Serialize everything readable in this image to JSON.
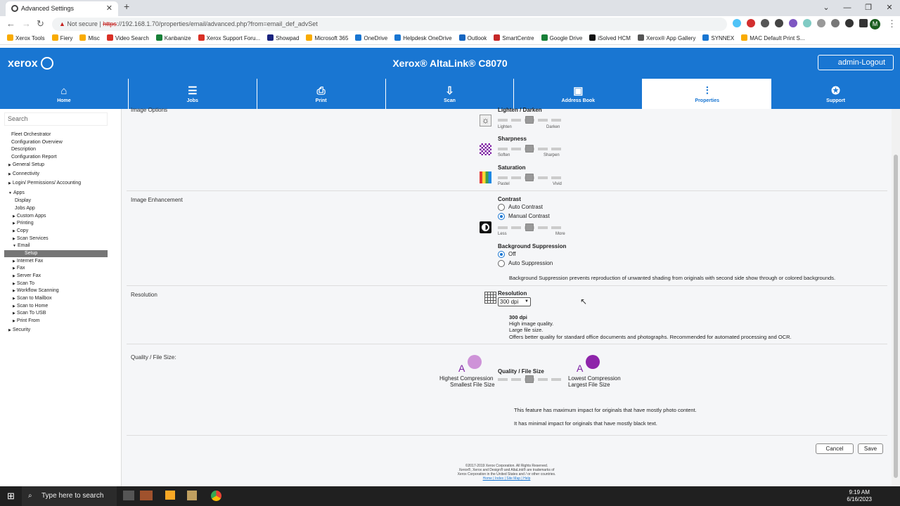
{
  "browser": {
    "tab_title": "Advanced Settings",
    "url_warning": "Not secure",
    "url_scheme": "https",
    "url_rest": "://192.168.1.70/properties/email/advanced.php?from=email_def_advSet"
  },
  "bookmarks": [
    {
      "label": "Xerox Tools",
      "color": "#f9ab00"
    },
    {
      "label": "Fiery",
      "color": "#f9ab00"
    },
    {
      "label": "Misc",
      "color": "#f9ab00"
    },
    {
      "label": "Video Search",
      "color": "#d93025"
    },
    {
      "label": "Kanbanize",
      "color": "#188038"
    },
    {
      "label": "Xerox Support Foru...",
      "color": "#d93025"
    },
    {
      "label": "Showpad",
      "color": "#1a237e"
    },
    {
      "label": "Microsoft 365",
      "color": "#f9ab00"
    },
    {
      "label": "OneDrive",
      "color": "#1976d2"
    },
    {
      "label": "Helpdesk OneDrive",
      "color": "#1976d2"
    },
    {
      "label": "Outlook",
      "color": "#1565c0"
    },
    {
      "label": "SmartCentre",
      "color": "#c62828"
    },
    {
      "label": "Google Drive",
      "color": "#188038"
    },
    {
      "label": "iSolved HCM",
      "color": "#111111"
    },
    {
      "label": "Xerox® App Gallery",
      "color": "#555555"
    },
    {
      "label": "SYNNEX",
      "color": "#1976d2"
    },
    {
      "label": "MAC Default Print S...",
      "color": "#f9ab00"
    }
  ],
  "header": {
    "logo": "xerox",
    "product": "Xerox® AltaLink® C8070",
    "logout": "admin-Logout"
  },
  "nav": [
    {
      "label": "Home",
      "icon": "⌂"
    },
    {
      "label": "Jobs",
      "icon": "☰"
    },
    {
      "label": "Print",
      "icon": "⎙"
    },
    {
      "label": "Scan",
      "icon": "⇩"
    },
    {
      "label": "Address Book",
      "icon": "▣"
    },
    {
      "label": "Properties",
      "icon": "⫶"
    },
    {
      "label": "Support",
      "icon": "✪"
    }
  ],
  "sidebar": {
    "search_placeholder": "Search",
    "items": [
      "Fleet Orchestrator",
      "Configuration Overview",
      "Description",
      "Configuration Report",
      "General Setup",
      "Connectivity",
      "Login/ Permissions/ Accounting",
      "Apps",
      "Display",
      "Jobs App",
      "Custom Apps",
      "Printing",
      "Copy",
      "Scan Services",
      "Email",
      "Setup",
      "Internet Fax",
      "Fax",
      "Server Fax",
      "Scan To",
      "Workflow Scanning",
      "Scan to Mailbox",
      "Scan to Home",
      "Scan To USB",
      "Print From",
      "Security"
    ]
  },
  "image_options": {
    "label": "Image Options",
    "lighten": {
      "title": "Lighten / Darken",
      "lo": "Lighten",
      "hi": "Darken",
      "level": 0.5
    },
    "sharpness": {
      "title": "Sharpness",
      "lo": "Soften",
      "hi": "Sharpen",
      "level": 0.5
    },
    "saturation": {
      "title": "Saturation",
      "lo": "Pastel",
      "hi": "Vivid",
      "level": 0.5
    }
  },
  "enhancement": {
    "label": "Image Enhancement",
    "contrast_title": "Contrast",
    "auto_contrast": "Auto Contrast",
    "manual_contrast": "Manual Contrast",
    "lo": "Less",
    "hi": "More",
    "contrast_level": 0.5,
    "bg_title": "Background Suppression",
    "bg_off": "Off",
    "bg_auto": "Auto Suppression",
    "bg_note": "Background Suppression prevents reproduction of unwanted shading from originals with second side show through or colored backgrounds."
  },
  "resolution": {
    "label": "Resolution",
    "title": "Resolution",
    "selected": "300 dpi",
    "desc_title": "300 dpi",
    "desc1": "High image quality.",
    "desc2": "Large file size.",
    "desc3": "Offers better quality for standard office documents and photographs. Recommended for automated processing and OCR."
  },
  "quality": {
    "label": "Quality / File Size:",
    "title": "Quality / File Size",
    "left1": "Highest Compression",
    "left2": "Smallest File Size",
    "right1": "Lowest Compression",
    "right2": "Largest File Size",
    "level": 0.5,
    "note1": "This feature has maximum impact for originals that have mostly photo content.",
    "note2": "It has minimal impact for originals that have mostly black text."
  },
  "buttons": {
    "cancel": "Cancel",
    "save": "Save"
  },
  "footer": {
    "l1": "©2017-2019  Xerox Corporation. All Rights Reserved.",
    "l2": "Xerox®, Xerox and Design® and AltaLink® are trademarks of",
    "l3": "Xerox Corporation in the United States and / or other countries.",
    "l4": "Home | Index | Site Map | Help"
  },
  "taskbar": {
    "search": "Type here to search",
    "time": "9:19 AM",
    "date": "6/16/2023"
  }
}
